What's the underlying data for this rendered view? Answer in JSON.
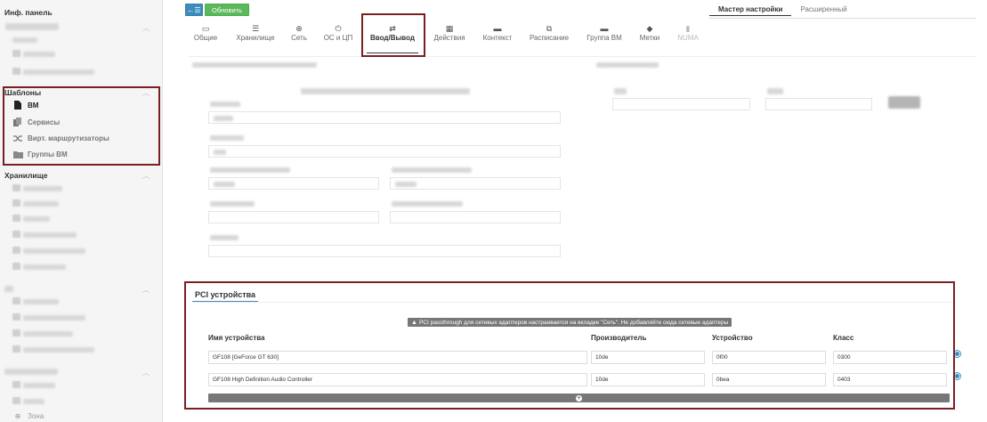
{
  "sidebar": {
    "dashboard_title": "Инф. панель",
    "templates": {
      "title": "Шаблоны",
      "items": [
        {
          "label": "ВМ",
          "icon": "file-icon",
          "active": true
        },
        {
          "label": "Сервисы",
          "icon": "copy-icon",
          "active": false
        },
        {
          "label": "Вирт. маршрутизаторы",
          "icon": "shuffle-icon",
          "active": false
        },
        {
          "label": "Группы ВМ",
          "icon": "folder-icon",
          "active": false
        }
      ]
    },
    "storage_title": "Хранилище",
    "partial_item": "Зона"
  },
  "toolbar": {
    "back_label": "←☰",
    "refresh_label": "Обновить"
  },
  "mode_tabs": [
    {
      "label": "Мастер настройки",
      "active": true
    },
    {
      "label": "Расширенный",
      "active": false
    }
  ],
  "tabs": [
    {
      "label": "Общие",
      "icon": "laptop-icon",
      "glyph": "▭"
    },
    {
      "label": "Хранилище",
      "icon": "tasks-icon",
      "glyph": "☰"
    },
    {
      "label": "Сеть",
      "icon": "globe-icon",
      "glyph": "⊕"
    },
    {
      "label": "ОС и ЦП",
      "icon": "power-icon",
      "glyph": "⏻"
    },
    {
      "label": "Ввод/Вывод",
      "icon": "exchange-icon",
      "glyph": "⇄",
      "active": true
    },
    {
      "label": "Действия",
      "icon": "calendar-icon",
      "glyph": "▦"
    },
    {
      "label": "Контекст",
      "icon": "folder-icon",
      "glyph": "▬"
    },
    {
      "label": "Расписание",
      "icon": "sitemap-icon",
      "glyph": "⧉"
    },
    {
      "label": "Группа ВМ",
      "icon": "folder-open-icon",
      "glyph": "▬"
    },
    {
      "label": "Метки",
      "icon": "tag-icon",
      "glyph": "◆"
    },
    {
      "label": "NUMA",
      "icon": "server-icon",
      "glyph": "▮",
      "disabled": true
    }
  ],
  "pci": {
    "title": "PCI устройства",
    "warning": "PCI passthrough для сетевых адаптеров настраивается на вкладке \"Сеть\". Не добавляйте сюда сетевые адаптеры",
    "columns": {
      "name": "Имя устройства",
      "vendor": "Производитель",
      "device": "Устройство",
      "class": "Класс"
    },
    "rows": [
      {
        "name": "GF108 [GeForce GT 630]",
        "vendor": "10de",
        "device": "0f00",
        "class": "0300"
      },
      {
        "name": "GF108 High Definition Audio Controller",
        "vendor": "10de",
        "device": "0bea",
        "class": "0403"
      }
    ]
  },
  "colors": {
    "primary": "#3c8dbc",
    "success": "#5cb85c",
    "highlight_box": "#7a1f22",
    "warning_bg": "#777777"
  }
}
